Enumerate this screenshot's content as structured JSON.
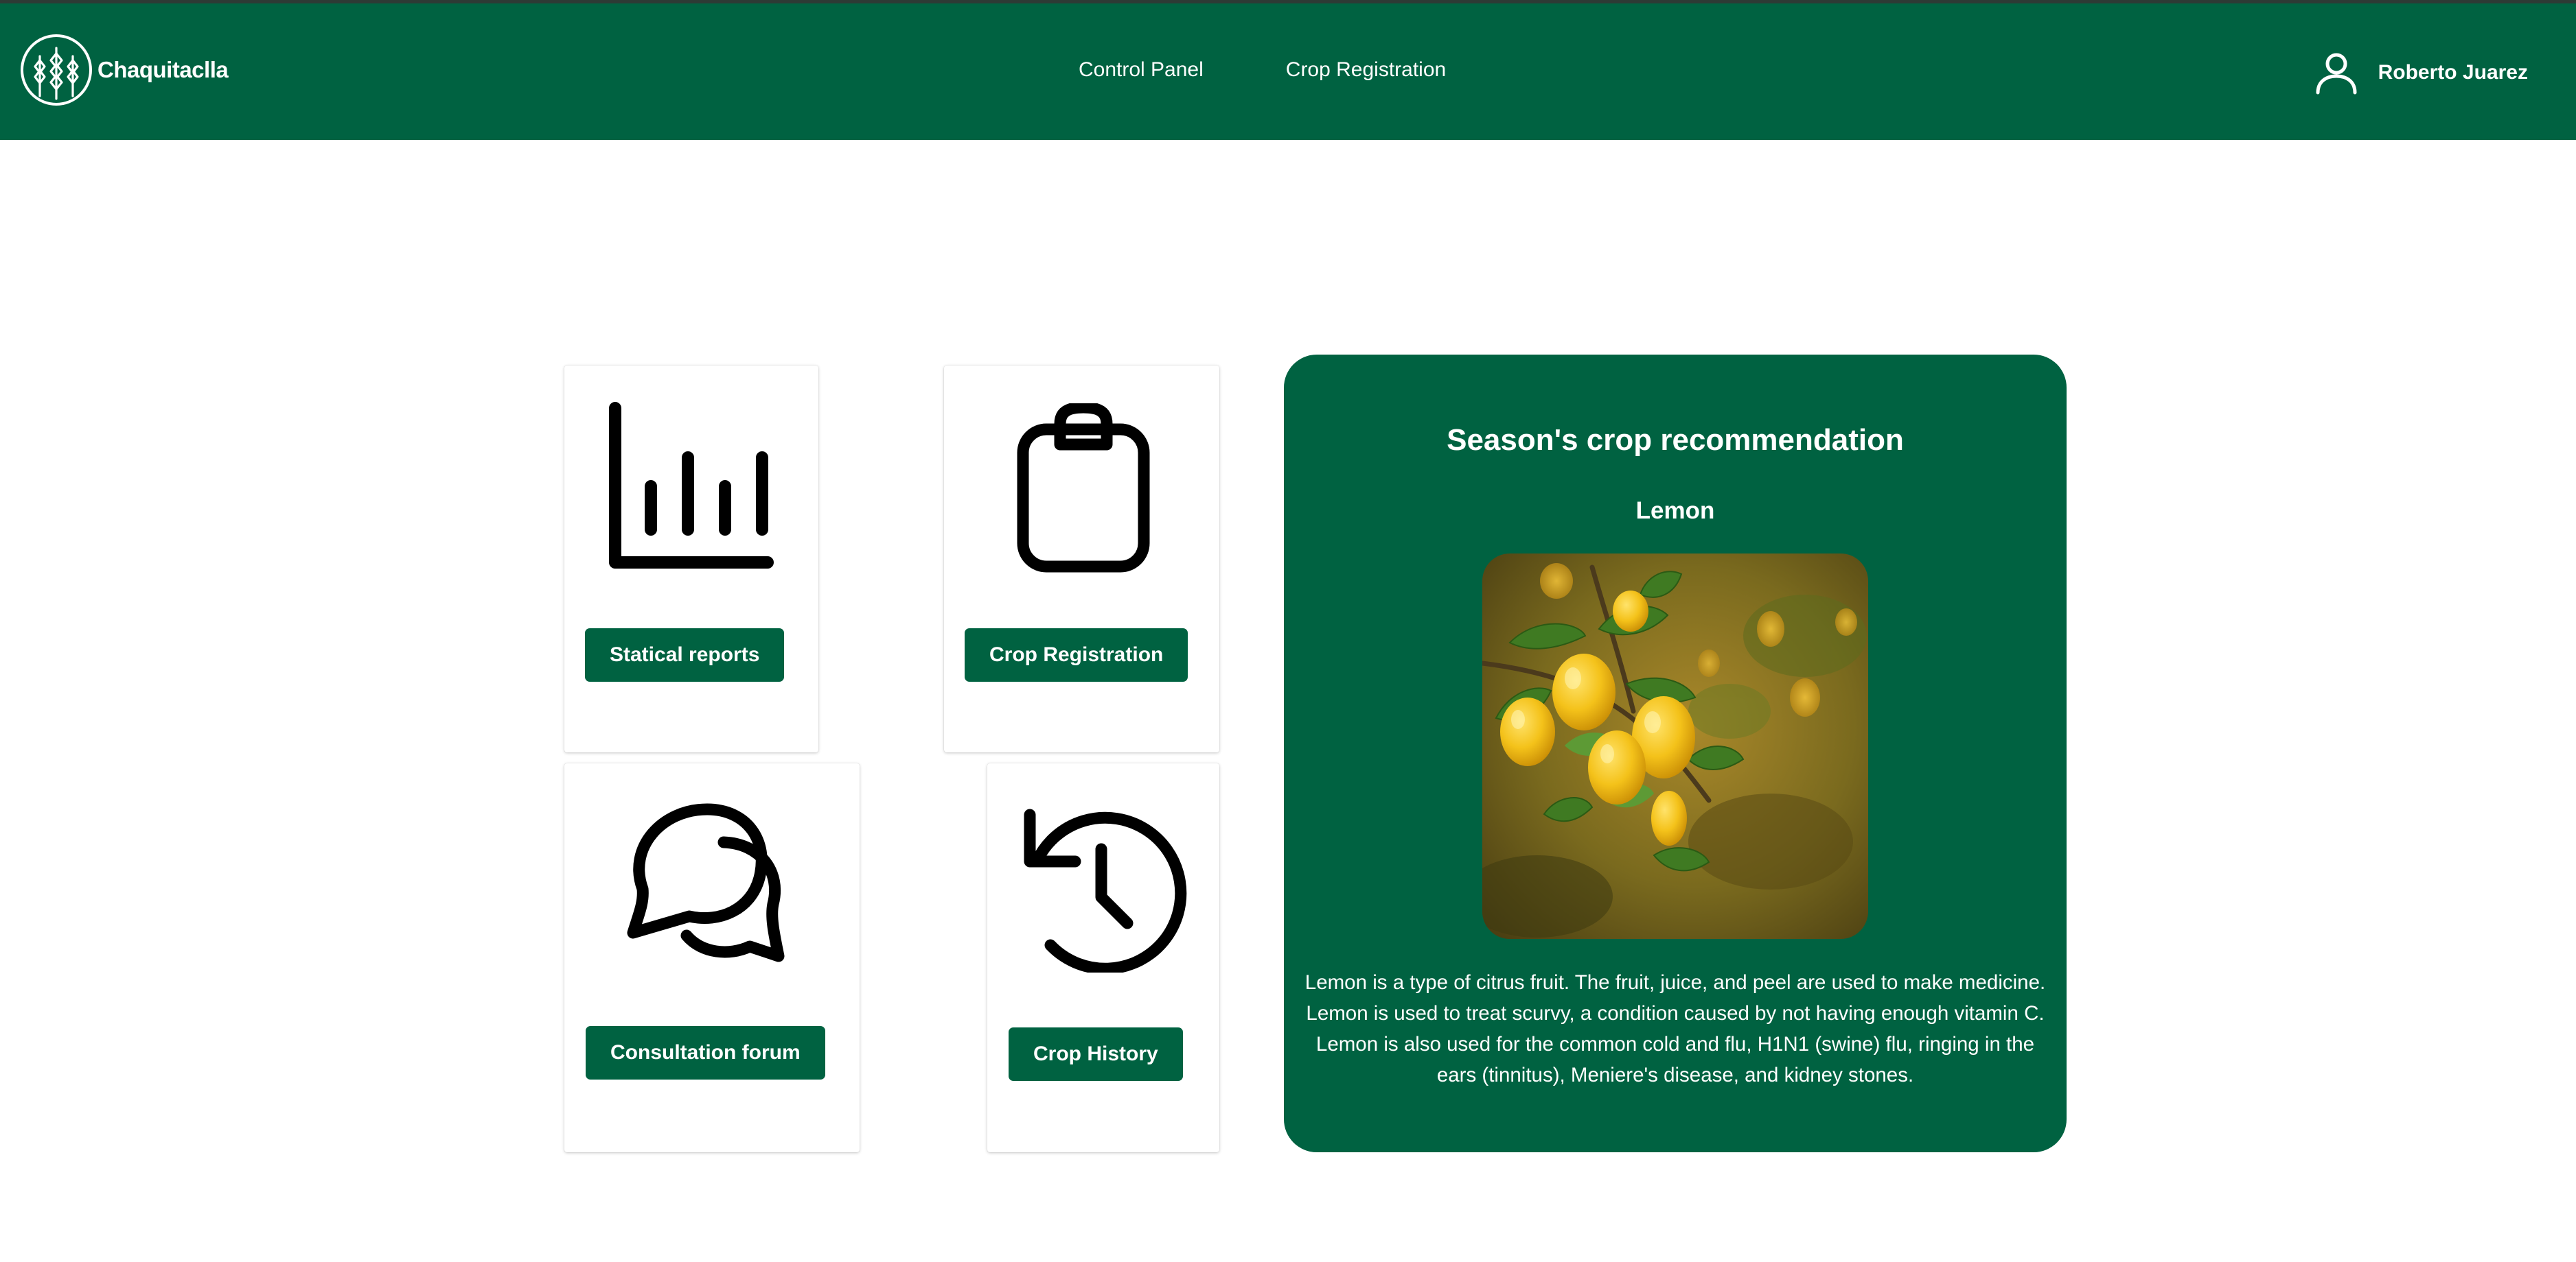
{
  "header": {
    "brand_name": "Chaquitaclla",
    "brand_logo_icon": "wheat-logo-icon",
    "nav": [
      {
        "label": "Control Panel"
      },
      {
        "label": "Crop Registration"
      }
    ],
    "user": {
      "name": "Roberto Juarez",
      "icon": "user-icon"
    }
  },
  "cards": [
    {
      "icon": "bar-chart-icon",
      "button_label": "Statical reports"
    },
    {
      "icon": "clipboard-icon",
      "button_label": "Crop Registration"
    },
    {
      "icon": "chat-bubbles-icon",
      "button_label": "Consultation forum"
    },
    {
      "icon": "history-icon",
      "button_label": "Crop History"
    }
  ],
  "recommendation": {
    "title": "Season's crop recommendation",
    "crop_name": "Lemon",
    "image_subject": "lemon-tree-photo",
    "description": "Lemon is a type of citrus fruit. The fruit, juice, and peel are used to make medicine. Lemon is used to treat scurvy, a condition caused by not having enough vitamin C. Lemon is also used for the common cold and flu, H1N1 (swine) flu, ringing in the ears (tinnitus), Meniere's disease, and kidney stones."
  },
  "colors": {
    "brand_green": "#006241",
    "text_light": "#ffffff",
    "icon_dark": "#000000"
  }
}
